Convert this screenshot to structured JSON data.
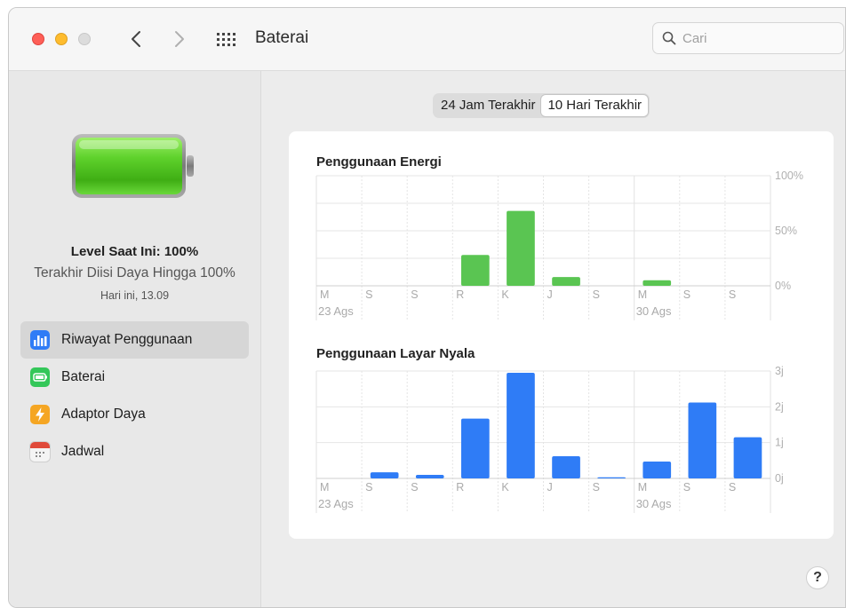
{
  "window": {
    "title": "Baterai"
  },
  "search": {
    "placeholder": "Cari"
  },
  "sidebar": {
    "level": "Level Saat Ini: 100%",
    "last_charged": "Terakhir Diisi Daya Hingga 100%",
    "time": "Hari ini, 13.09",
    "items": [
      {
        "label": "Riwayat Penggunaan",
        "icon": "usage-history-icon",
        "color": "#2f7cf6",
        "selected": true
      },
      {
        "label": "Baterai",
        "icon": "battery-icon",
        "color": "#34c759",
        "selected": false
      },
      {
        "label": "Adaptor Daya",
        "icon": "power-adapter-icon",
        "color": "#f5a623",
        "selected": false
      },
      {
        "label": "Jadwal",
        "icon": "calendar-icon",
        "color": "#e04a3a",
        "selected": false
      }
    ]
  },
  "tabs": [
    {
      "label": "24 Jam Terakhir",
      "active": false
    },
    {
      "label": "10 Hari Terakhir",
      "active": true
    }
  ],
  "help_label": "?",
  "chart_data": [
    {
      "type": "bar",
      "title": "Penggunaan Energi",
      "categories": [
        "M",
        "S",
        "S",
        "R",
        "K",
        "J",
        "S",
        "M",
        "S",
        "S"
      ],
      "date_labels": [
        {
          "index": 0,
          "label": "23 Ags"
        },
        {
          "index": 7,
          "label": "30 Ags"
        }
      ],
      "values": [
        0,
        0,
        0,
        28,
        68,
        8,
        0,
        5,
        0,
        0
      ],
      "unit": "%",
      "yticks": [
        "0%",
        "50%",
        "100%"
      ],
      "ylim": [
        0,
        100
      ],
      "color": "#5ac552"
    },
    {
      "type": "bar",
      "title": "Penggunaan Layar Nyala",
      "categories": [
        "M",
        "S",
        "S",
        "R",
        "K",
        "J",
        "S",
        "M",
        "S",
        "S"
      ],
      "date_labels": [
        {
          "index": 0,
          "label": "23 Ags"
        },
        {
          "index": 7,
          "label": "30 Ags"
        }
      ],
      "values": [
        0,
        0.17,
        0.1,
        1.67,
        2.95,
        0.62,
        0.03,
        0.47,
        2.12,
        1.15
      ],
      "unit": "j",
      "yticks": [
        "0j",
        "1j",
        "2j",
        "3j"
      ],
      "ylim": [
        0,
        3
      ],
      "color": "#2f7cf6"
    }
  ]
}
